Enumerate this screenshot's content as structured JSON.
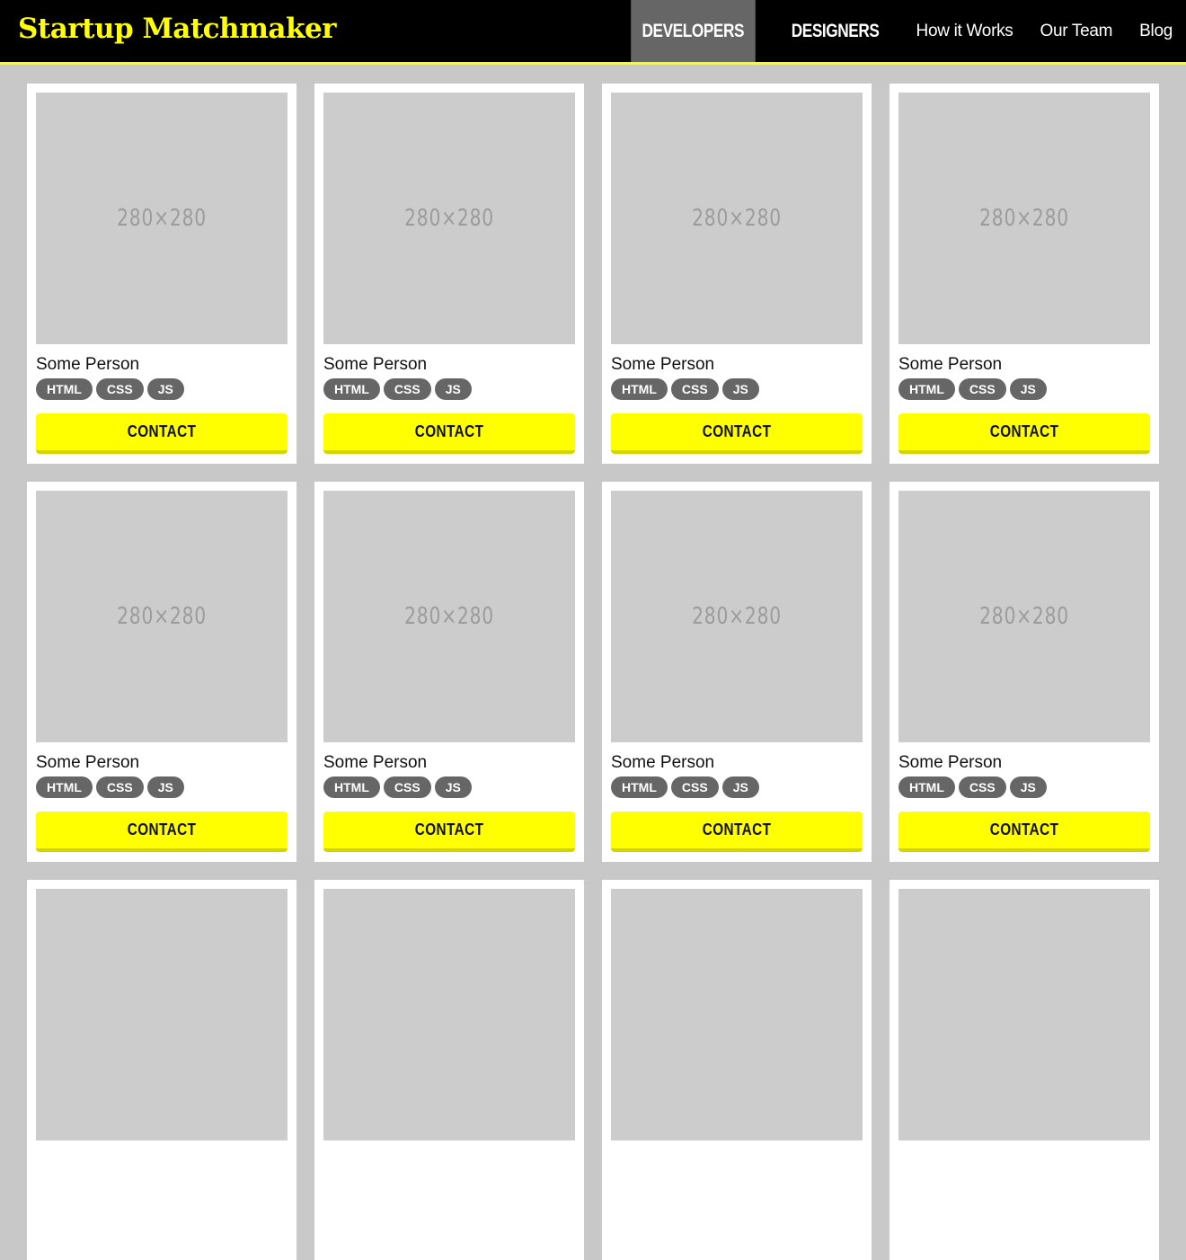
{
  "header": {
    "brand": "Startup Matchmaker",
    "nav": [
      {
        "label": "DEVELOPERS",
        "active": true,
        "style": "condensed"
      },
      {
        "label": "DESIGNERS",
        "active": false,
        "style": "condensed"
      },
      {
        "label": "How it Works",
        "active": false,
        "style": "plain"
      },
      {
        "label": "Our Team",
        "active": false,
        "style": "plain"
      },
      {
        "label": "Blog",
        "active": false,
        "style": "plain"
      }
    ]
  },
  "cards": [
    {
      "photo": "280×280",
      "name": "Some Person",
      "tags": [
        "HTML",
        "CSS",
        "JS"
      ],
      "button": "CONTACT"
    },
    {
      "photo": "280×280",
      "name": "Some Person",
      "tags": [
        "HTML",
        "CSS",
        "JS"
      ],
      "button": "CONTACT"
    },
    {
      "photo": "280×280",
      "name": "Some Person",
      "tags": [
        "HTML",
        "CSS",
        "JS"
      ],
      "button": "CONTACT"
    },
    {
      "photo": "280×280",
      "name": "Some Person",
      "tags": [
        "HTML",
        "CSS",
        "JS"
      ],
      "button": "CONTACT"
    },
    {
      "photo": "280×280",
      "name": "Some Person",
      "tags": [
        "HTML",
        "CSS",
        "JS"
      ],
      "button": "CONTACT"
    },
    {
      "photo": "280×280",
      "name": "Some Person",
      "tags": [
        "HTML",
        "CSS",
        "JS"
      ],
      "button": "CONTACT"
    },
    {
      "photo": "280×280",
      "name": "Some Person",
      "tags": [
        "HTML",
        "CSS",
        "JS"
      ],
      "button": "CONTACT"
    },
    {
      "photo": "280×280",
      "name": "Some Person",
      "tags": [
        "HTML",
        "CSS",
        "JS"
      ],
      "button": "CONTACT"
    },
    {
      "photo": "",
      "name": "",
      "tags": [],
      "button": ""
    },
    {
      "photo": "",
      "name": "",
      "tags": [],
      "button": ""
    },
    {
      "photo": "",
      "name": "",
      "tags": [],
      "button": ""
    },
    {
      "photo": "",
      "name": "",
      "tags": [],
      "button": ""
    }
  ],
  "colors": {
    "accent": "#ffff00",
    "header_bg": "#000000",
    "page_bg": "#c8c8c8",
    "tag_bg": "#666666",
    "placeholder": "#cccccc"
  }
}
